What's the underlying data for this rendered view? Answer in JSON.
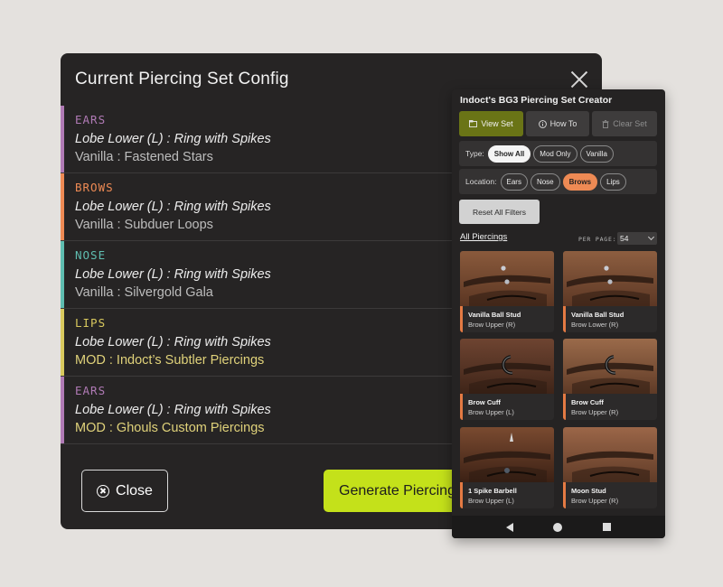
{
  "modal": {
    "title": "Current Piercing Set Config",
    "entries": [
      {
        "category": "EARS",
        "item": "Lobe Lower (L) : Ring with Spikes",
        "source": "Vanilla : Fastened Stars",
        "color": "#b07ab5",
        "source_color": "#bdbdbd"
      },
      {
        "category": "BROWS",
        "item": "Lobe Lower (L) : Ring with Spikes",
        "source": "Vanilla : Subduer Loops",
        "color": "#ee8a54",
        "source_color": "#bdbdbd"
      },
      {
        "category": "NOSE",
        "item": "Lobe Lower (L) : Ring with Spikes",
        "source": "Vanilla : Silvergold Gala",
        "color": "#5fbdb0",
        "source_color": "#bdbdbd"
      },
      {
        "category": "LIPS",
        "item": "Lobe Lower (L) : Ring with Spikes",
        "source": "MOD : Indoct’s Subtler Piercings",
        "color": "#d9c95e",
        "source_color": "#e0d27a"
      },
      {
        "category": "EARS",
        "item": "Lobe Lower (L) : Ring with Spikes",
        "source": "MOD : Ghouls Custom Piercings",
        "color": "#b07ab5",
        "source_color": "#e0d27a"
      }
    ],
    "close_label": "Close",
    "generate_label": "Generate Piercing"
  },
  "panel": {
    "title": "Indoct's BG3 Piercing Set Creator",
    "tabs": {
      "view": "View Set",
      "how": "How To",
      "clear": "Clear Set"
    },
    "type_label": "Type:",
    "type_options": [
      "Show All",
      "Mod Only",
      "Vanilla"
    ],
    "type_selected": "Show All",
    "location_label": "Location:",
    "location_options": [
      "Ears",
      "Nose",
      "Brows",
      "Lips"
    ],
    "location_selected": "Brows",
    "reset_label": "Reset All Filters",
    "all_link": "All Piercings",
    "per_page_label": "PER PAGE:",
    "per_page_value": "54",
    "cards": [
      {
        "name": "Vanilla Ball Stud",
        "location": "Brow Upper (R)",
        "icon": "ball-stud"
      },
      {
        "name": "Vanilla Ball Stud",
        "location": "Brow Lower (R)",
        "icon": "ball-stud"
      },
      {
        "name": "Brow Cuff",
        "location": "Brow Upper (L)",
        "icon": "cuff"
      },
      {
        "name": "Brow Cuff",
        "location": "Brow Upper (R)",
        "icon": "cuff"
      },
      {
        "name": "1 Spike Barbell",
        "location": "Brow Upper (L)",
        "icon": "spike-barbell"
      },
      {
        "name": "Moon Stud",
        "location": "Brow Upper (R)",
        "icon": "moon"
      }
    ]
  },
  "colors": {
    "accent_lime": "#c4e11a",
    "accent_orange": "#ee8a54",
    "view_tab": "#6a7416"
  }
}
